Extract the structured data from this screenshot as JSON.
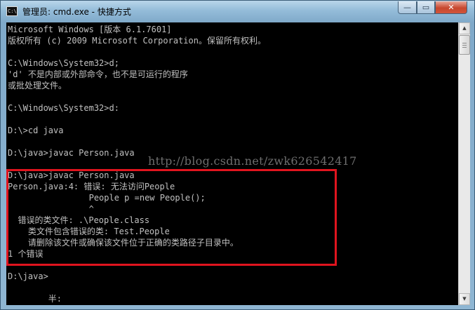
{
  "window": {
    "title": "管理员: cmd.exe - 快捷方式",
    "icon_text": "C:\\",
    "minimize_glyph": "—",
    "maximize_glyph": "▭",
    "close_glyph": "✕"
  },
  "console": {
    "lines": [
      "Microsoft Windows [版本 6.1.7601]",
      "版权所有 (c) 2009 Microsoft Corporation。保留所有权利。",
      "",
      "C:\\Windows\\System32>d;",
      "'d' 不是内部或外部命令，也不是可运行的程序",
      "或批处理文件。",
      "",
      "C:\\Windows\\System32>d:",
      "",
      "D:\\>cd java",
      "",
      "D:\\java>javac Person.java",
      "",
      "D:\\java>javac Person.java",
      "Person.java:4: 错误: 无法访问People",
      "                People p =new People();",
      "                ^",
      "  错误的类文件: .\\People.class",
      "    类文件包含错误的类: Test.People",
      "    请删除该文件或确保该文件位于正确的类路径子目录中。",
      "1 个错误",
      "",
      "D:\\java>",
      "",
      "        半:"
    ],
    "watermark": "http://blog.csdn.net/zwk626542417"
  },
  "scrollbar": {
    "up_glyph": "▲",
    "down_glyph": "▼"
  }
}
